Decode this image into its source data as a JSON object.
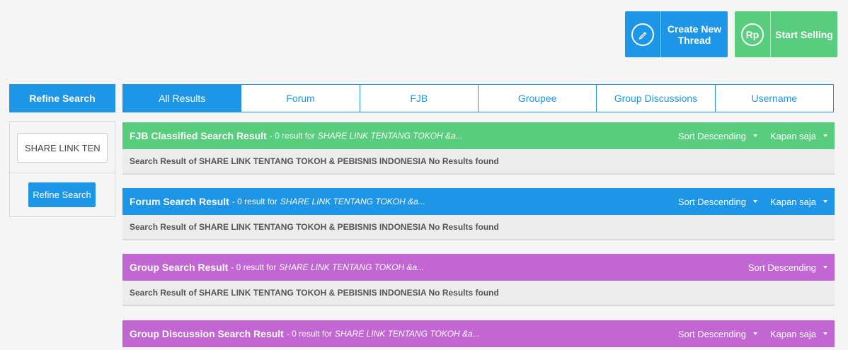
{
  "actions": {
    "create_thread": "Create New Thread",
    "start_selling": "Start Selling",
    "rp_icon_text": "Rp"
  },
  "sidebar": {
    "header": "Refine Search",
    "input_value": "SHARE LINK TENT",
    "button_label": "Refine Search"
  },
  "tabs": [
    {
      "label": "All Results",
      "active": true
    },
    {
      "label": "Forum",
      "active": false
    },
    {
      "label": "FJB",
      "active": false
    },
    {
      "label": "Groupee",
      "active": false
    },
    {
      "label": "Group Discussions",
      "active": false
    },
    {
      "label": "Username",
      "active": false
    }
  ],
  "sections": [
    {
      "title": "FJB Classified Search Result",
      "count": "- 0 result for",
      "query": "SHARE LINK TENTANG TOKOH &a...",
      "sort": "Sort Descending",
      "time": "Kapan saja",
      "body": "Search Result of SHARE LINK TENTANG TOKOH & PEBISNIS INDONESIA No Results found",
      "color": "#58cd7d"
    },
    {
      "title": "Forum Search Result",
      "count": "- 0 result for",
      "query": "SHARE LINK TENTANG TOKOH &a...",
      "sort": "Sort Descending",
      "time": "Kapan saja",
      "body": "Search Result of SHARE LINK TENTANG TOKOH & PEBISNIS INDONESIA No Results found",
      "color": "#1e96e8"
    },
    {
      "title": "Group Search Result",
      "count": "- 0 result for",
      "query": "SHARE LINK TENTANG TOKOH &a...",
      "sort": "Sort Descending",
      "body": "Search Result of SHARE LINK TENTANG TOKOH & PEBISNIS INDONESIA No Results found",
      "color": "#c266d3"
    },
    {
      "title": "Group Discussion Search Result",
      "count": "- 0 result for",
      "query": "SHARE LINK TENTANG TOKOH &a...",
      "sort": "Sort Descending",
      "time": "Kapan saja",
      "color": "#c266d3"
    }
  ]
}
